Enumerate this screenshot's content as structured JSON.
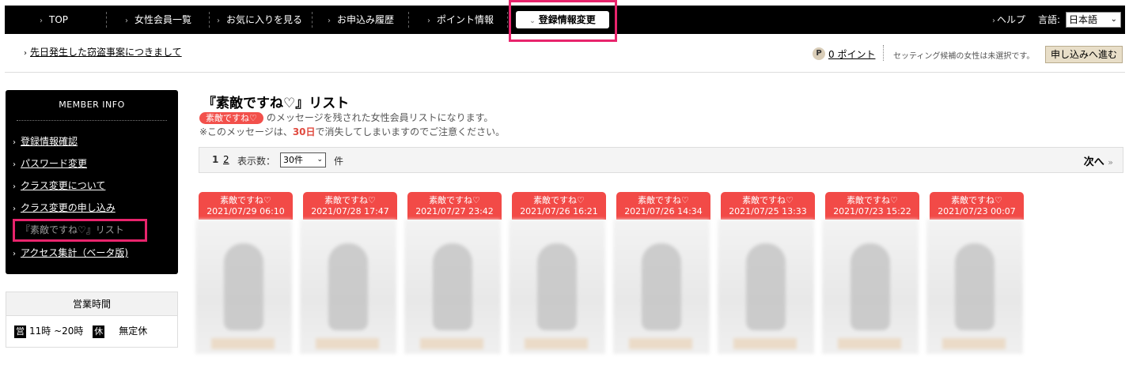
{
  "nav": {
    "items": [
      "TOP",
      "女性会員一覧",
      "お気に入りを見る",
      "お申込み履歴",
      "ポイント情報"
    ],
    "active": "登録情報変更",
    "help": "ヘルプ",
    "lang_label": "言語:",
    "lang_value": "日本語"
  },
  "notice": "先日発生した窃盗事案につきまして",
  "points": {
    "icon": "P",
    "link": "0 ポイント"
  },
  "setting_note": "セッティング候補の女性は未選択です。",
  "apply_button": "申し込みへ進む",
  "sidebar": {
    "title": "MEMBER INFO",
    "items": [
      "登録情報確認",
      "パスワード変更",
      "クラス変更について",
      "クラス変更の申し込み",
      "『素敵ですね♡』リスト",
      "アクセス集計（ベータ版)"
    ],
    "hours_title": "営業時間",
    "open_badge": "営",
    "hours": "11時 ~20時",
    "closed_badge": "休",
    "closed_text": "無定休"
  },
  "main": {
    "title": "『素敵ですね♡』リスト",
    "pill": "素敵ですね♡",
    "sub1": "のメッセージを残された女性会員リストになります。",
    "sub2_pre": "※このメッセージは、",
    "sub2_days": "30日",
    "sub2_post": "で消失してしまいますのでご注意ください。"
  },
  "pager": {
    "page1": "1",
    "page2": "2",
    "per_label": "表示数：",
    "per_value": "30件",
    "unit": "件",
    "next": "次へ",
    "next_arrow": "»"
  },
  "cards": [
    {
      "tag": "素敵ですね♡",
      "date": "2021/07/29 06:10"
    },
    {
      "tag": "素敵ですね♡",
      "date": "2021/07/28 17:47"
    },
    {
      "tag": "素敵ですね♡",
      "date": "2021/07/27 23:42"
    },
    {
      "tag": "素敵ですね♡",
      "date": "2021/07/26 16:21"
    },
    {
      "tag": "素敵ですね♡",
      "date": "2021/07/26 14:34"
    },
    {
      "tag": "素敵ですね♡",
      "date": "2021/07/25 13:33"
    },
    {
      "tag": "素敵ですね♡",
      "date": "2021/07/23 15:22"
    },
    {
      "tag": "素敵ですね♡",
      "date": "2021/07/23 00:07"
    }
  ],
  "colors": {
    "highlight": "#e8246c",
    "tag": "#f24a47",
    "nav_bg": "#000000"
  }
}
